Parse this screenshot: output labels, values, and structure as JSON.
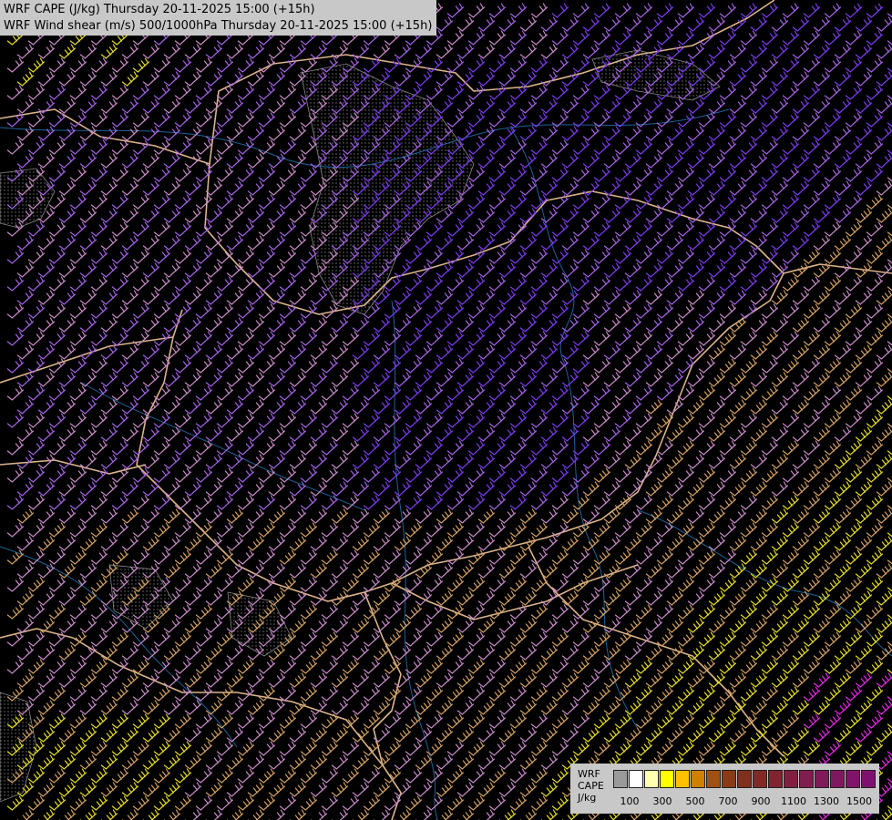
{
  "header": {
    "line1": "WRF CAPE (J/kg) Thursday 20-11-2025 15:00 (+15h)",
    "line2": "WRF Wind shear (m/s) 500/1000hPa Thursday 20-11-2025 15:00 (+15h)"
  },
  "legend": {
    "label_model": "WRF",
    "label_var": "CAPE",
    "label_unit": "J/kg",
    "swatches": [
      "#9a9a9a",
      "#ffffff",
      "#ffffb0",
      "#ffff00",
      "#ffc000",
      "#d08000",
      "#a05010",
      "#8a3a14",
      "#80301c",
      "#802a28",
      "#802430",
      "#802040",
      "#801e50",
      "#801a58",
      "#801860",
      "#801468",
      "#801070"
    ],
    "ticks": [
      "100",
      "300",
      "500",
      "700",
      "900",
      "1100",
      "1300",
      "1500"
    ]
  },
  "map_colors": {
    "background": "#000000",
    "border": "#dcb48c",
    "river": "#1f6ea8",
    "barb_violet": "#a564e6",
    "barb_purple": "#7d3cf0",
    "barb_pink": "#c88cc8",
    "barb_tan": "#d2a064",
    "barb_yellow": "#e6dc28",
    "barb_magenta": "#e628e6",
    "cape_outline": "#a0a0a0"
  }
}
